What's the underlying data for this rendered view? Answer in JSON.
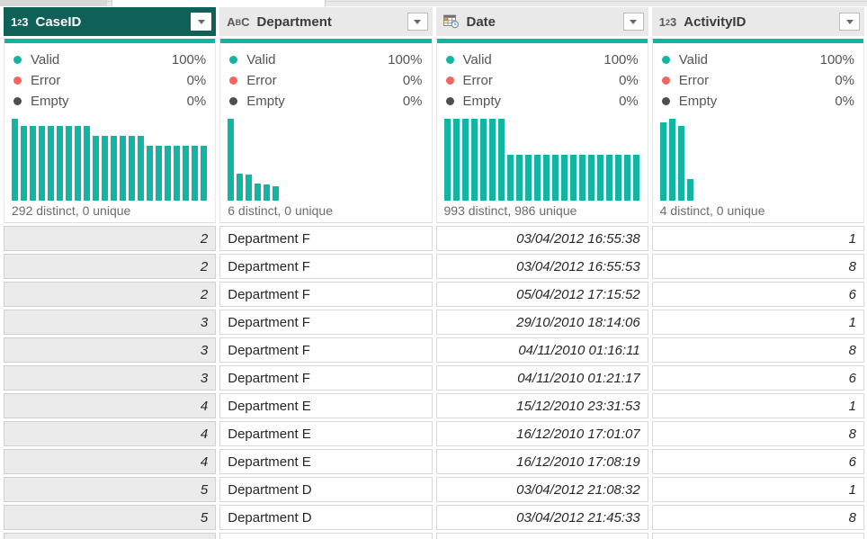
{
  "labels": {
    "valid": "Valid",
    "error": "Error",
    "empty": "Empty"
  },
  "colors": {
    "accent_teal": "#12b5a2",
    "selected_header_teal": "#0f6057",
    "error_red": "#f4655f",
    "empty_gray": "#4f4f4f"
  },
  "columns": [
    {
      "name": "CaseID",
      "type_icon": "number-123-icon",
      "icon_text": {
        "pre": "1",
        "sup": "2",
        "post": "3"
      },
      "selected": true,
      "align": "right",
      "value_italic": true,
      "quality": {
        "valid": "100%",
        "error": "0%",
        "empty": "0%"
      },
      "distinct_text": "292 distinct, 0 unique",
      "histogram": [
        100,
        91,
        91,
        91,
        91,
        91,
        91,
        91,
        91,
        79,
        79,
        79,
        79,
        79,
        79,
        67,
        67,
        67,
        67,
        67,
        67,
        67
      ]
    },
    {
      "name": "Department",
      "type_icon": "text-abc-icon",
      "icon_text": {
        "pre": "A",
        "sup": "B",
        "post": "C"
      },
      "selected": false,
      "align": "left",
      "value_italic": false,
      "quality": {
        "valid": "100%",
        "error": "0%",
        "empty": "0%"
      },
      "distinct_text": "6 distinct, 0 unique",
      "histogram": [
        100,
        33,
        32,
        21,
        20,
        18
      ]
    },
    {
      "name": "Date",
      "type_icon": "datetime-icon",
      "icon_text": null,
      "selected": false,
      "align": "right",
      "value_italic": true,
      "quality": {
        "valid": "100%",
        "error": "0%",
        "empty": "0%"
      },
      "distinct_text": "993 distinct, 986 unique",
      "histogram": [
        100,
        100,
        100,
        100,
        100,
        100,
        100,
        56,
        56,
        56,
        56,
        56,
        56,
        56,
        56,
        56,
        56,
        56,
        56,
        56,
        56,
        56
      ]
    },
    {
      "name": "ActivityID",
      "type_icon": "number-123-icon",
      "icon_text": {
        "pre": "1",
        "sup": "2",
        "post": "3"
      },
      "selected": false,
      "align": "right",
      "value_italic": true,
      "quality": {
        "valid": "100%",
        "error": "0%",
        "empty": "0%"
      },
      "distinct_text": "4 distinct, 0 unique",
      "histogram": [
        96,
        100,
        91,
        26
      ]
    }
  ],
  "rows": [
    [
      "2",
      "Department F",
      "03/04/2012 16:55:38",
      "1"
    ],
    [
      "2",
      "Department F",
      "03/04/2012 16:55:53",
      "8"
    ],
    [
      "2",
      "Department F",
      "05/04/2012 17:15:52",
      "6"
    ],
    [
      "3",
      "Department F",
      "29/10/2010 18:14:06",
      "1"
    ],
    [
      "3",
      "Department F",
      "04/11/2010 01:16:11",
      "8"
    ],
    [
      "3",
      "Department F",
      "04/11/2010 01:21:17",
      "6"
    ],
    [
      "4",
      "Department E",
      "15/12/2010 23:31:53",
      "1"
    ],
    [
      "4",
      "Department E",
      "16/12/2010 17:01:07",
      "8"
    ],
    [
      "4",
      "Department E",
      "16/12/2010 17:08:19",
      "6"
    ],
    [
      "5",
      "Department D",
      "03/04/2012 21:08:32",
      "1"
    ],
    [
      "5",
      "Department D",
      "03/04/2012 21:45:33",
      "8"
    ]
  ]
}
